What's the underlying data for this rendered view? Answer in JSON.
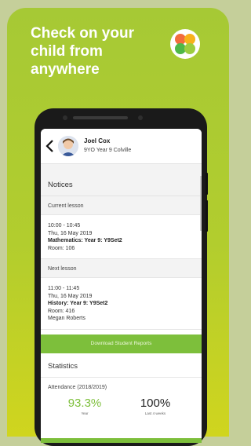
{
  "promo": {
    "headline": "Check on your child from anywhere"
  },
  "colors": {
    "brand_green": "#a6c935",
    "button_green": "#7dbf3b",
    "stat_green": "#7dbf3b"
  },
  "student": {
    "name": "Joel Cox",
    "details": "9YO  Year 9  Colville"
  },
  "notices": {
    "title": "Notices"
  },
  "current_lesson": {
    "heading": "Current lesson",
    "time": "10:00 - 10:45",
    "date": "Thu, 16 May 2019",
    "subject": "Mathematics: Year 9: Y9Set2",
    "room": "Room: 106"
  },
  "next_lesson": {
    "heading": "Next lesson",
    "time": "11:00 - 11:45",
    "date": "Thu, 16 May 2019",
    "subject": "History: Year 9: Y9Set2",
    "room": "Room: 416",
    "teacher": "Megan Roberts"
  },
  "download_button": "Download Student Reports",
  "statistics": {
    "title": "Statistics",
    "attendance_label": "Attendance (2018/2019)",
    "year_value": "93.3%",
    "year_caption": "Year",
    "recent_value": "100%",
    "recent_caption": "Last 4 weeks"
  }
}
